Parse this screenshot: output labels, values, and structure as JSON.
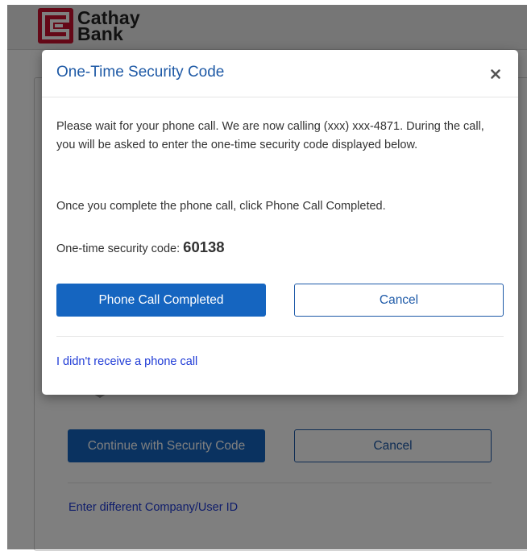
{
  "brand": {
    "name_line1": "Cathay",
    "name_line2": "Bank",
    "color": "#c8102e"
  },
  "background_page": {
    "continue_button_label": "Continue with Security Code",
    "cancel_button_label": "Cancel",
    "change_id_link": "Enter different Company/User ID"
  },
  "modal": {
    "title": "One-Time Security Code",
    "close_icon": "close-icon",
    "instructions": "Please wait for your phone call. We are now calling (xxx) xxx-4871. During the call, you will be asked to enter the one-time security code displayed below.",
    "completion_note": "Once you complete the phone call, click Phone Call Completed.",
    "code_label": "One-time security code:",
    "code_value": "60138",
    "primary_button_label": "Phone Call Completed",
    "secondary_button_label": "Cancel",
    "no_call_link": "I didn't receive a phone call"
  },
  "colors": {
    "accent": "#1565c0",
    "title": "#1f5aa6",
    "link": "#1f3bd6"
  }
}
